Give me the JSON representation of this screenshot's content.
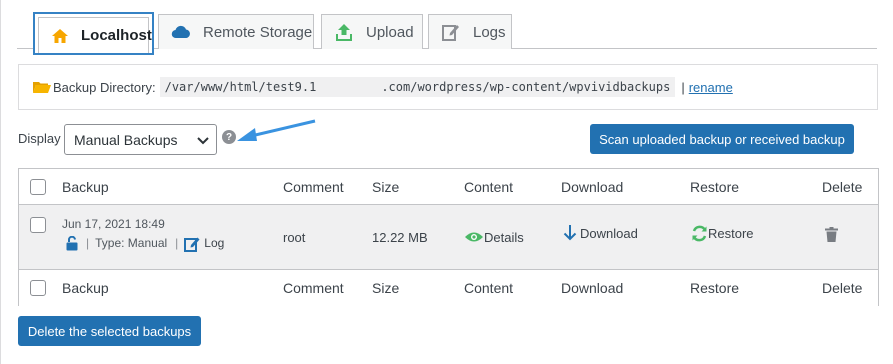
{
  "tabs": [
    {
      "label": "Localhost",
      "icon": "home-icon",
      "active": true
    },
    {
      "label": "Remote Storage",
      "icon": "cloud-icon"
    },
    {
      "label": "Upload",
      "icon": "upload-icon"
    },
    {
      "label": "Logs",
      "icon": "edit-icon"
    }
  ],
  "backup_directory": {
    "label": "Backup Directory:",
    "path": "/var/www/html/test9.1         .com/wordpress/wp-content/wpvividbackups",
    "separator": "|",
    "rename_link": "rename"
  },
  "display": {
    "label": "Display",
    "selected": "Manual Backups",
    "help": "?"
  },
  "scan_button": "Scan uploaded backup or received backup",
  "table": {
    "columns": [
      "Backup",
      "Comment",
      "Size",
      "Content",
      "Download",
      "Restore",
      "Delete"
    ],
    "rows": [
      {
        "date": "Jun 17, 2021 18:49",
        "type": "Type: Manual",
        "log": "Log",
        "comment": "root",
        "size": "12.22 MB",
        "content": "Details",
        "download": "Download",
        "restore": "Restore"
      }
    ]
  },
  "delete_selected_button": "Delete the selected backups",
  "colors": {
    "accent": "#2271b1",
    "active_tab_border": "#3582c4",
    "green": "#4ab866",
    "orange": "#f7a600"
  }
}
